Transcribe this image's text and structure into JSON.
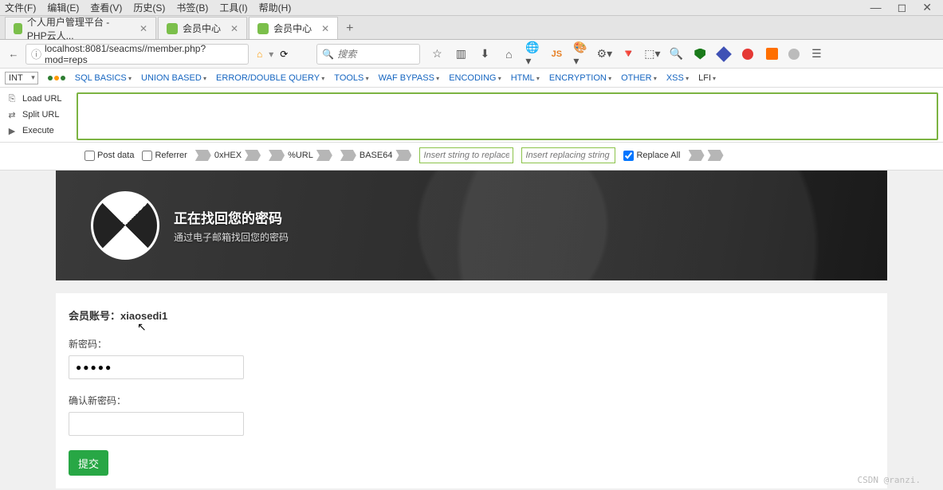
{
  "menubar": [
    "文件(F)",
    "编辑(E)",
    "查看(V)",
    "历史(S)",
    "书签(B)",
    "工具(I)",
    "帮助(H)"
  ],
  "window_controls": {
    "min": "—",
    "max": "◻",
    "close": "✕"
  },
  "tabs": [
    {
      "label": "个人用户管理平台 - PHP云人...",
      "active": false
    },
    {
      "label": "会员中心",
      "active": false
    },
    {
      "label": "会员中心",
      "active": true
    }
  ],
  "url": "localhost:8081/seacms//member.php?mod=reps",
  "search_placeholder": "搜索",
  "hackbar": {
    "encoding_select": "INT",
    "menus": [
      "SQL BASICS",
      "UNION BASED",
      "ERROR/DOUBLE QUERY",
      "TOOLS",
      "WAF BYPASS",
      "ENCODING",
      "HTML",
      "ENCRYPTION",
      "OTHER",
      "XSS",
      "LFI"
    ],
    "side": [
      {
        "icon": "⎘",
        "label": "Load URL"
      },
      {
        "icon": "⇄",
        "label": "Split URL"
      },
      {
        "icon": "▶",
        "label": "Execute"
      }
    ],
    "opts": {
      "post": "Post data",
      "referrer": "Referrer",
      "hex": "0xHEX",
      "url": "%URL",
      "b64": "BASE64",
      "replace_from_ph": "Insert string to replace",
      "replace_to_ph": "Insert replacing string",
      "replace_all": "Replace All"
    }
  },
  "banner": {
    "title": "正在找回您的密码",
    "subtitle": "通过电子邮箱找回您的密码"
  },
  "form": {
    "account_label": "会员账号：",
    "account_value": "xiaosedi1",
    "pw_label": "新密码：",
    "pw_value": "●●●●●",
    "pw2_label": "确认新密码：",
    "pw2_value": "",
    "submit": "提交"
  },
  "watermark": "CSDN @ranzi."
}
